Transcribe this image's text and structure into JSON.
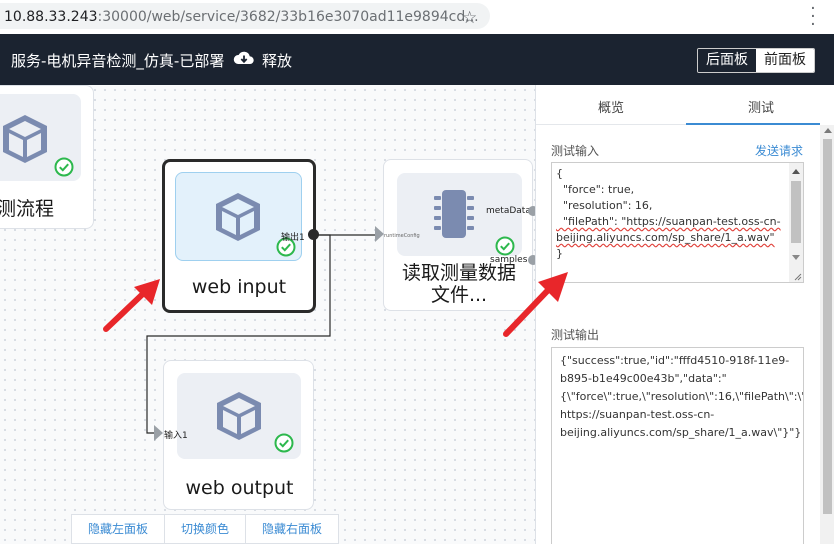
{
  "browser": {
    "url_host": "10.88.33.243",
    "url_rest": ":30000/web/service/3682/33b16e3070ad11e9894cd..."
  },
  "header": {
    "title": "服务-电机异音检测_仿真-已部署",
    "release_label": "释放",
    "back_panel_label": "后面板",
    "front_panel_label": "前面板"
  },
  "canvas": {
    "nodes": {
      "partial": {
        "label": "测流程"
      },
      "web_input": {
        "label": "web input",
        "out_port": "输出1"
      },
      "reader": {
        "label_line1": "读取测量数据",
        "label_line2": "文件...",
        "in_port": "runtimeConfig",
        "out_port_1": "metaData",
        "out_port_2": "samples"
      },
      "web_output": {
        "label": "web output",
        "in_port": "输入1"
      }
    },
    "bottom_bar": {
      "hide_left": "隐藏左面板",
      "switch_color": "切换颜色",
      "hide_right": "隐藏右面板"
    }
  },
  "right_panel": {
    "tabs": [
      "概览",
      "测试"
    ],
    "active_tab": "测试",
    "test_input_label": "测试输入",
    "send_request": "发送请求",
    "test_input_lines": [
      "{",
      "  \"force\": true,",
      "  \"resolution\": 16,",
      "  \"filePath\": \"https://suanpan-test.oss-cn-",
      "beijing.aliyuncs.com/sp_share/1_a.wav\"",
      "}"
    ],
    "test_output_label": "测试输出",
    "test_output_lines": [
      "{\"success\":true,\"id\":\"fffd4510-918f-11e9-",
      "b895-b1e49c00e43b\",\"data\":\"",
      "{\\\"force\\\":true,\\\"resolution\\\":16,\\\"filePath\\\":\\\"",
      "https://suanpan-test.oss-cn-",
      "beijing.aliyuncs.com/sp_share/1_a.wav\\\"}\"}"
    ]
  },
  "colors": {
    "header_bg": "#1b2330",
    "accent": "#3b8bd3",
    "success": "#2db84d",
    "annotation_arrow": "#e8262a"
  },
  "icons": {
    "cloud": "cloud-download-icon",
    "node": "cube-icon",
    "chip": "chip-icon",
    "status": "check-circle-icon"
  }
}
